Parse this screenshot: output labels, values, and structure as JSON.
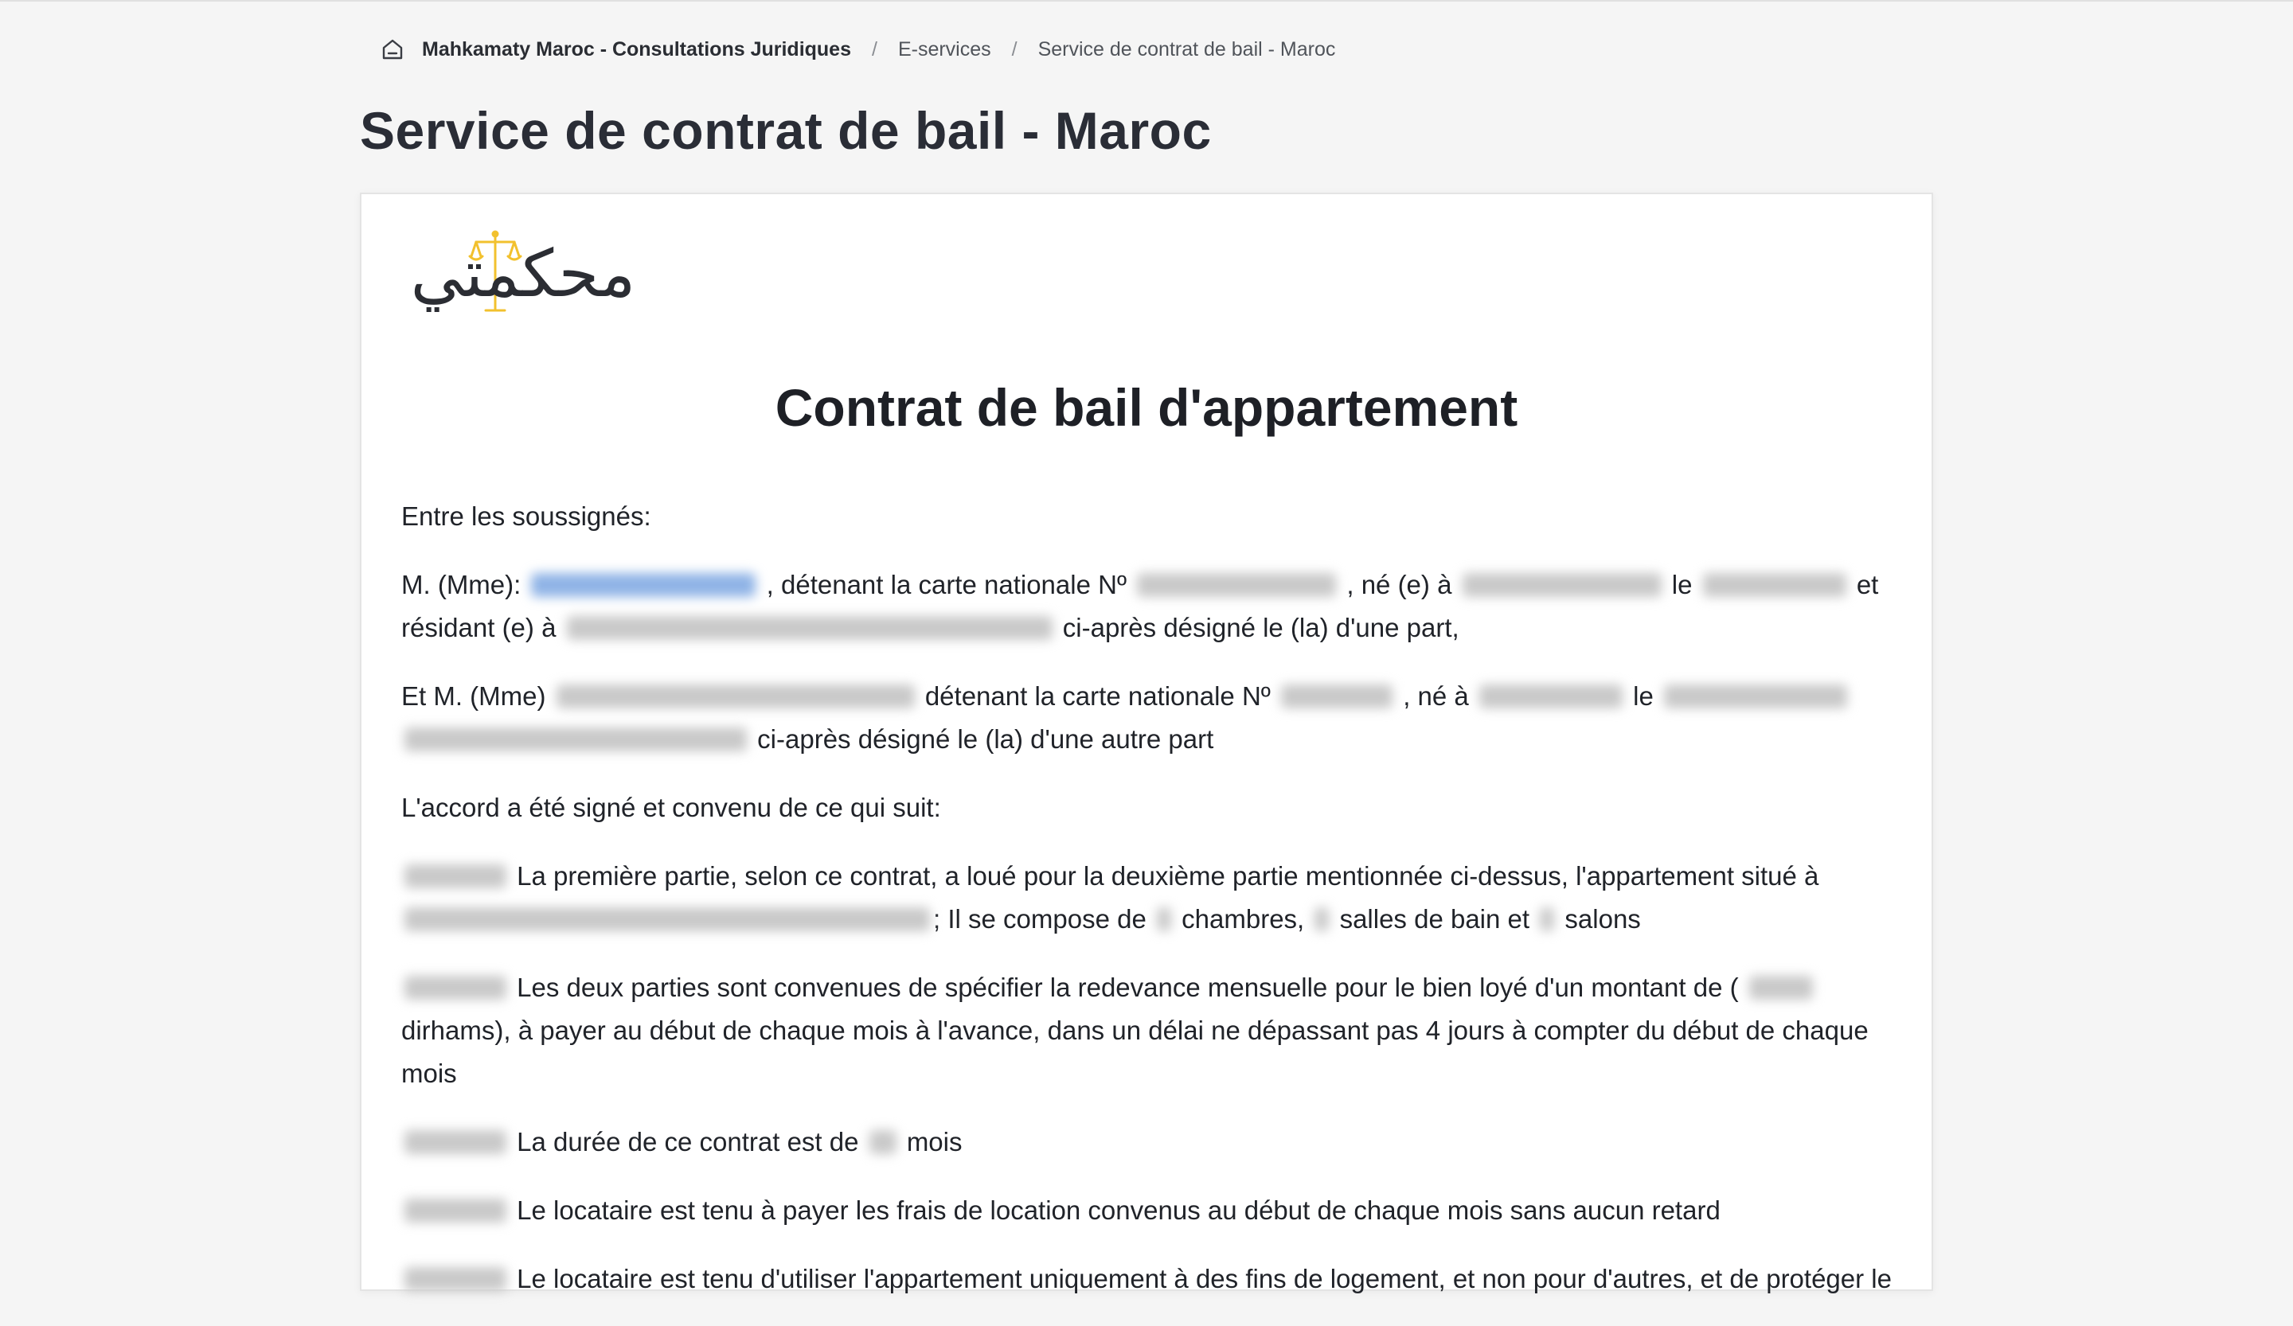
{
  "breadcrumb": {
    "home_icon": "home-icon",
    "site": "Mahkamaty Maroc - Consultations Juridiques",
    "section": "E-services",
    "current": "Service de contrat de bail - Maroc"
  },
  "page": {
    "title": "Service de contrat de bail - Maroc"
  },
  "logo": {
    "text": "محكمتي",
    "accent_color": "#f2c12e",
    "ink_color": "#2b2d33"
  },
  "document": {
    "title": "Contrat de bail d'appartement",
    "intro": "Entre les soussignés:",
    "party1": {
      "prefix": "M. (Mme):",
      "id_text": ", détenant la carte nationale Nº",
      "born_text": ", né (e) à",
      "le_text": "le",
      "et_text": "et",
      "resident_text": "résidant (e) à",
      "designation": "ci-après désigné le (la) d'une part,"
    },
    "party2": {
      "prefix": "Et M. (Mme)",
      "id_text": "détenant la carte nationale Nº",
      "born_text": ", né à",
      "le_text": "le",
      "designation": "ci-après désigné le (la) d'une autre part"
    },
    "agreement": "L'accord a été signé et convenu de ce qui suit:",
    "clause1": {
      "text": "La première partie, selon ce contrat, a loué pour la deuxième partie mentionnée ci-dessus, l'appartement situé à",
      "composed": "; Il se compose de",
      "rooms": "chambres,",
      "baths": "salles de bain et",
      "salons": "salons"
    },
    "clause2": {
      "text": "Les deux parties sont convenues de spécifier la redevance mensuelle pour le bien loyé d'un montant de (",
      "rest": "dirhams), à payer au début de chaque mois à l'avance, dans un délai ne dépassant pas 4 jours à compter du début de chaque mois"
    },
    "clause3": {
      "text": "La durée de ce contrat est de",
      "unit": "mois"
    },
    "clause4": {
      "text": "Le locataire est tenu à payer les frais de location convenus au début de chaque mois sans aucun retard"
    },
    "clause5": {
      "text": "Le locataire est tenu d'utiliser l'appartement uniquement à des fins de logement, et non pour d'autres, et de protéger le"
    }
  }
}
